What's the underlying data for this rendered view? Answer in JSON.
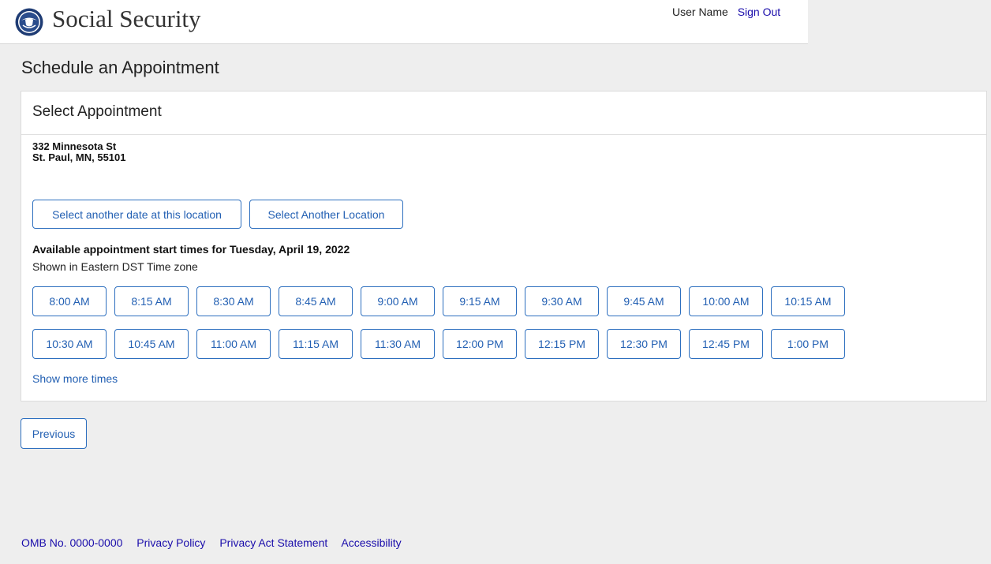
{
  "header": {
    "brand": "Social Security",
    "user_name": "User Name",
    "sign_out": "Sign Out"
  },
  "page_title": "Schedule an Appointment",
  "card": {
    "title": "Select Appointment",
    "address_line1": "332 Minnesota St",
    "address_line2": "St. Paul, MN, 55101",
    "select_date_button": "Select another date at this location",
    "select_location_button": "Select  Another Location",
    "available_heading": "Available appointment start times for Tuesday, April 19, 2022",
    "timezone_note": "Shown in Eastern DST Time zone",
    "times": [
      "8:00 AM",
      "8:15 AM",
      "8:30 AM",
      "8:45 AM",
      "9:00 AM",
      "9:15 AM",
      "9:30 AM",
      "9:45 AM",
      "10:00 AM",
      "10:15 AM",
      "10:30 AM",
      "10:45 AM",
      "11:00 AM",
      "11:15 AM",
      "11:30 AM",
      "12:00 PM",
      "12:15 PM",
      "12:30 PM",
      "12:45 PM",
      "1:00 PM"
    ],
    "show_more": "Show more times"
  },
  "previous_button": "Previous",
  "footer": {
    "omb": "OMB No. 0000-0000",
    "privacy_policy": "Privacy Policy",
    "privacy_act": "Privacy Act Statement",
    "accessibility": "Accessibility"
  },
  "colors": {
    "link": "#1a0dab",
    "button_border": "#2d6fbf",
    "button_text": "#2360b3",
    "page_bg": "#eeeeee"
  }
}
